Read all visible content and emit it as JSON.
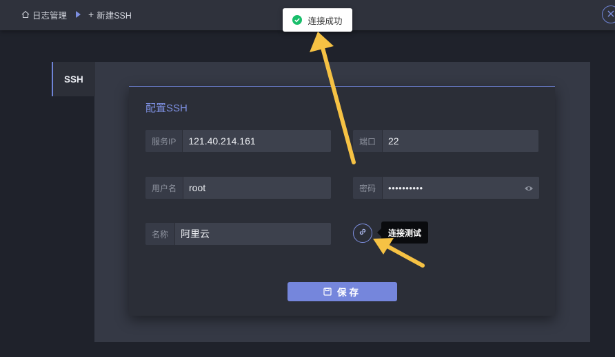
{
  "breadcrumb": {
    "root_icon": "home-icon",
    "root": "日志管理",
    "separator_icon": "triangle-right-icon",
    "current": "新建SSH"
  },
  "header": {
    "close_icon": "close-icon"
  },
  "sidebar_tab": {
    "label": "SSH"
  },
  "dialog": {
    "title": "配置SSH",
    "fields": {
      "ip": {
        "label": "服务IP",
        "value": "121.40.214.161"
      },
      "port": {
        "label": "端口",
        "value": "22"
      },
      "username": {
        "label": "用户名",
        "value": "root"
      },
      "password": {
        "label": "密码",
        "value": "••••••••••",
        "toggle_icon": "eye-icon"
      },
      "name": {
        "label": "名称",
        "value": "阿里云"
      }
    },
    "test_connection": {
      "icon": "link-icon",
      "tooltip": "连接测试"
    },
    "save": {
      "icon": "save-icon",
      "label": "保存"
    }
  },
  "toast": {
    "icon": "check-circle-icon",
    "message": "连接成功",
    "color": "#19be6b"
  },
  "colors": {
    "accent": "#7586dc",
    "annotation_arrow": "#f6c244"
  }
}
